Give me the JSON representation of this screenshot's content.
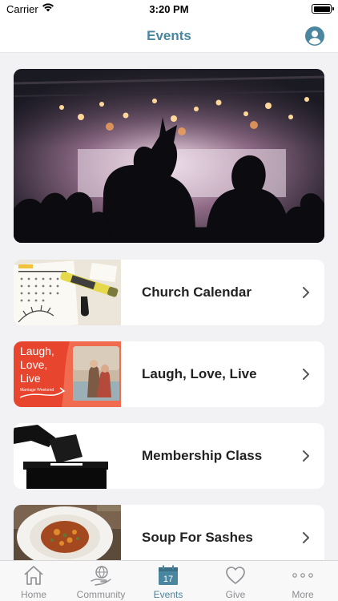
{
  "status_bar": {
    "carrier": "Carrier",
    "time": "3:20 PM"
  },
  "nav": {
    "title": "Events",
    "accent_color": "#4a86a0",
    "profile_icon": "person-circle-icon"
  },
  "hero": {
    "image": "concert-crowd-photo"
  },
  "events": [
    {
      "title": "Church Calendar",
      "thumb": "calendar-photo"
    },
    {
      "title": "Laugh, Love, Live",
      "thumb": "marriage-weekend-photo"
    },
    {
      "title": "Membership Class",
      "thumb": "ballot-box-photo"
    },
    {
      "title": "Soup For Sashes",
      "thumb": "soup-bowl-photo"
    }
  ],
  "thumb_text": {
    "laugh_line1": "Laugh,",
    "laugh_line2": "Love,",
    "laugh_line3": "Live",
    "laugh_sub": "Marriage Weekend"
  },
  "tab_bar": {
    "items": [
      {
        "label": "Home",
        "icon": "house-icon"
      },
      {
        "label": "Community",
        "icon": "globe-hand-icon"
      },
      {
        "label": "Events",
        "icon": "calendar-icon",
        "day": "17"
      },
      {
        "label": "Give",
        "icon": "heart-icon"
      },
      {
        "label": "More",
        "icon": "ellipsis-icon"
      }
    ],
    "active": "Events"
  }
}
